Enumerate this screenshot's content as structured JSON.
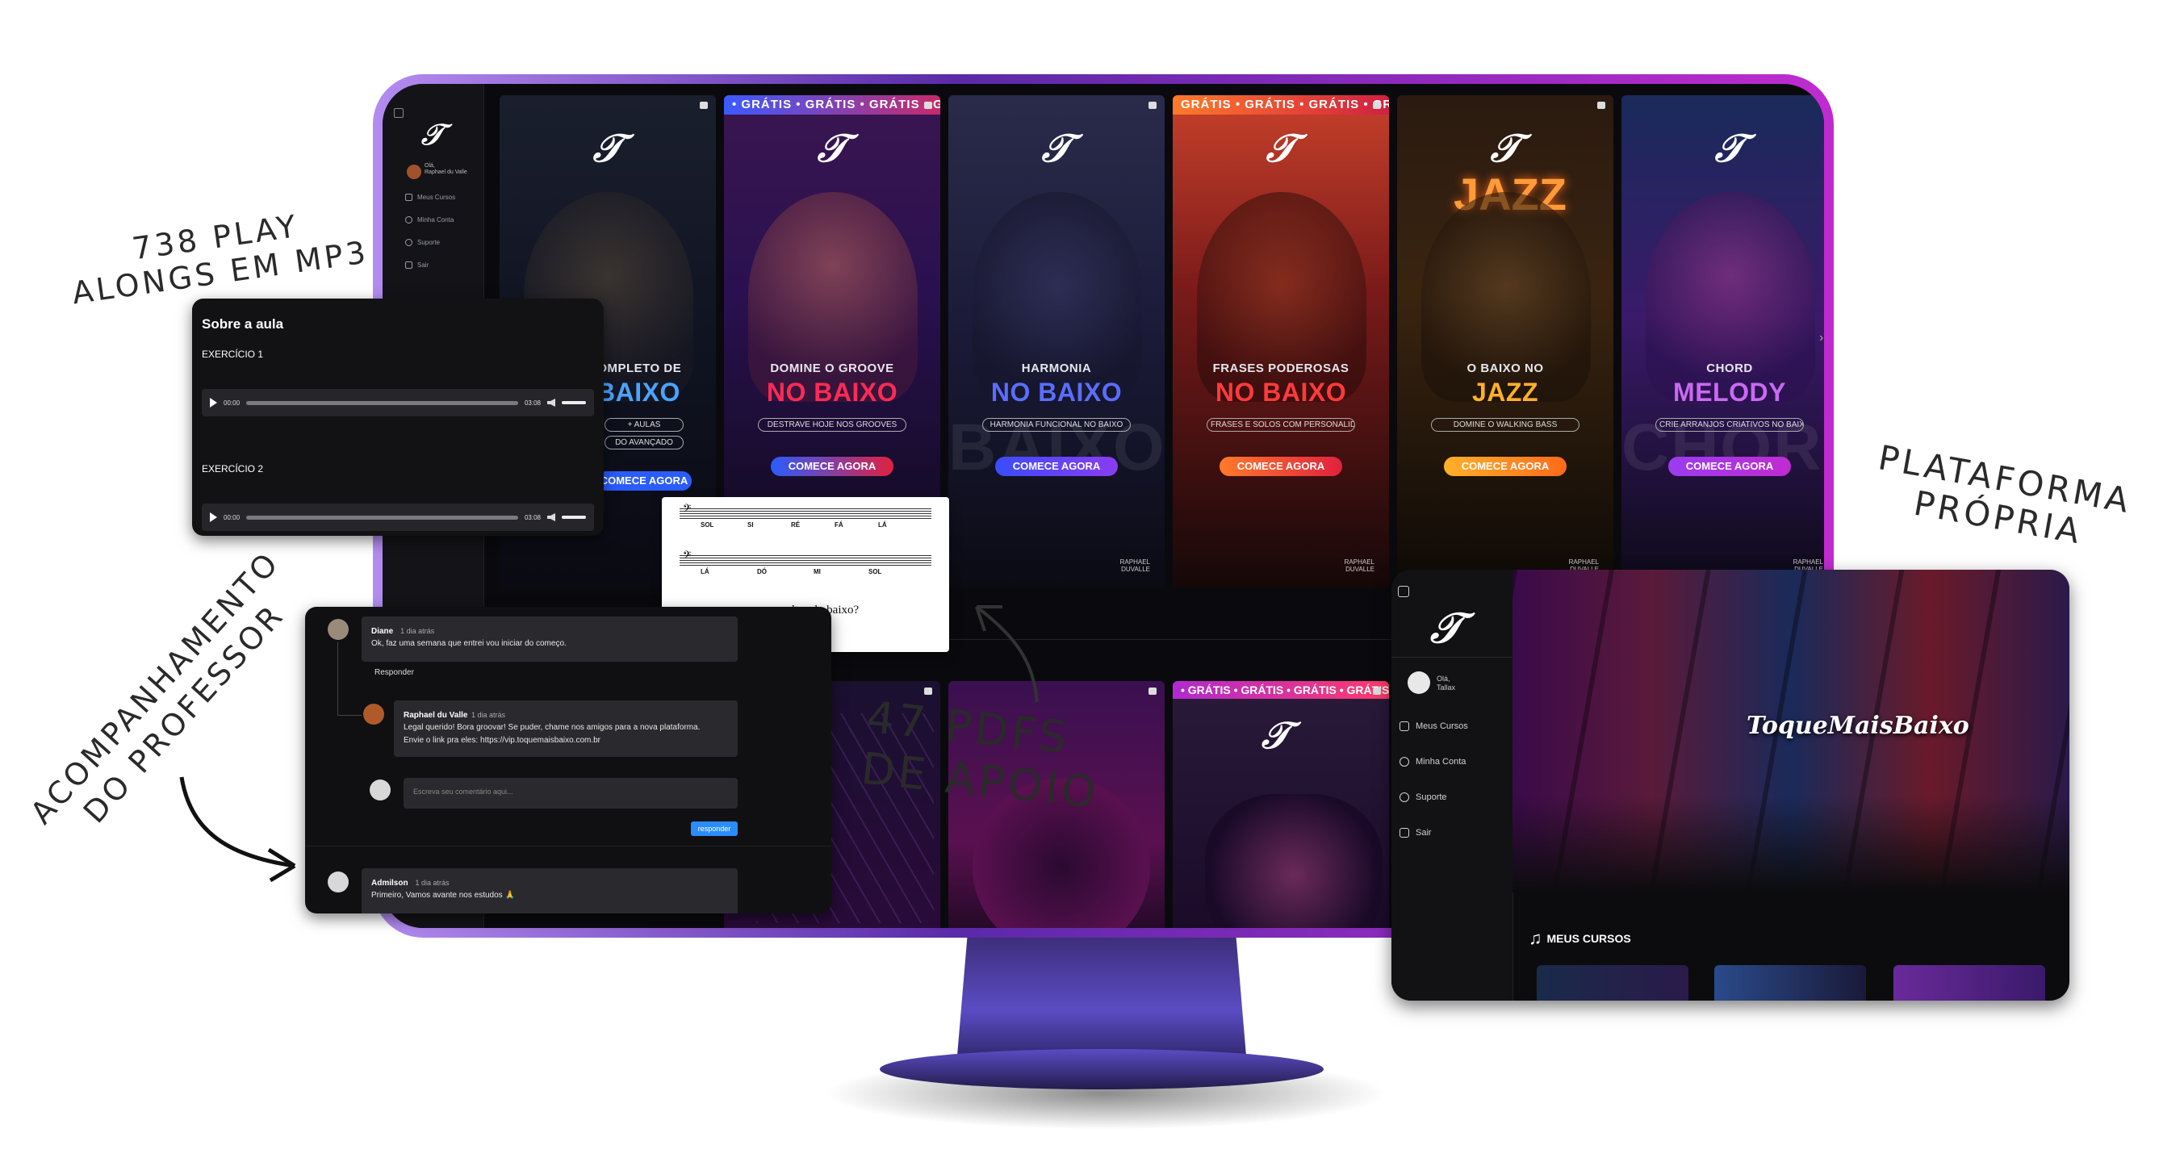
{
  "annotations": {
    "play_alongs_line1": "738 PLAY",
    "play_alongs_line2": "ALONGS EM MP3",
    "pdfs_line1": "47 PDFS",
    "pdfs_line2": "DE APOIO",
    "platform_line1": "PLATAFORMA",
    "platform_line2": "PRÓPRIA",
    "professor_line1": "ACOMPANHAMENTO",
    "professor_line2": "DO PROFESSOR"
  },
  "main_sidebar": {
    "greeting": "Olá,",
    "user_name": "Raphael du Valle",
    "items": [
      "Meus Cursos",
      "Minha Conta",
      "Suporte",
      "Sair"
    ]
  },
  "cards": [
    {
      "banner": "",
      "sub": "COMPLETO DE",
      "big": "BAIXO",
      "tag": "+ AULAS",
      "tag2": "DO AVANÇADO",
      "cta": "COMECE AGORA",
      "bg_word": "",
      "signature": ""
    },
    {
      "banner": "• GRÁTIS • GRÁTIS • GRÁTIS • GRÁTIS",
      "sub": "DOMINE O GROOVE",
      "big": "NO BAIXO",
      "tag": "DESTRAVE HOJE NOS GROOVES",
      "cta": "COMECE AGORA",
      "bg_word": "",
      "signature": ""
    },
    {
      "banner": "",
      "sub": "HARMONIA",
      "big": "NO BAIXO",
      "tag": "HARMONIA FUNCIONAL NO BAIXO",
      "cta": "COMECE AGORA",
      "bg_word": "BAIXO",
      "signature": "RAPHAEL DUVALLE"
    },
    {
      "banner": "GRÁTIS • GRÁTIS • GRÁTIS • GRÁTIS",
      "sub": "FRASES PODEROSAS",
      "big": "NO BAIXO",
      "tag": "FRASES E SOLOS COM PERSONALIDADE",
      "cta": "COMECE AGORA",
      "bg_word": "",
      "signature": "RAPHAEL DUVALLE"
    },
    {
      "banner": "",
      "sub": "O BAIXO NO",
      "big": "JAZZ",
      "tag": "DOMINE O WALKING BASS",
      "cta": "COMECE AGORA",
      "bg_word": "",
      "signature": "RAPHAEL DUVALLE"
    },
    {
      "banner": "",
      "sub": "CHORD",
      "big": "MELODY",
      "tag": "CRIE ARRANJOS CRIATIVOS NO BAIXO",
      "cta": "COMECE AGORA",
      "bg_word": "CHORD",
      "signature": "RAPHAEL DUVALLE"
    }
  ],
  "bottom_cards": [
    {
      "banner": ""
    },
    {
      "banner": ""
    },
    {
      "banner": "• GRÁTIS • GRÁTIS • GRÁTIS • GRÁTIS"
    }
  ],
  "neon_sign": "JAZZ",
  "audio_panel": {
    "title": "Sobre a aula",
    "exercises": [
      {
        "label": "EXERCÍCIO 1",
        "start_time": "00:00",
        "end_time": "03:08"
      },
      {
        "label": "EXERCÍCIO 2",
        "start_time": "00:00",
        "end_time": "03:08"
      }
    ]
  },
  "pdf_panel": {
    "row1_notes": [
      "SOL",
      "SI",
      "RÉ",
      "FÁ",
      "LÁ"
    ],
    "row2_notes": [
      "LÁ",
      "DÓ",
      "MI",
      "SOL"
    ],
    "question": "...as soltas do baixo?"
  },
  "comments_panel": {
    "comments": [
      {
        "name": "Diane",
        "time": "1 dia atrás",
        "text": "Ok, faz uma semana que entrei vou iniciar do começo."
      },
      {
        "name": "Raphael du Valle",
        "time": "1 dia atrás",
        "text": "Legal querido! Bora groovar! Se puder, chame nos amigos para a nova plataforma. Envie o link pra eles: https://vip.toquemaisbaixo.com.br"
      },
      {
        "name": "Admilson",
        "time": "1 dia atrás",
        "text": "Primeiro, Vamos avante nos estudos 🙏"
      }
    ],
    "reply_label": "Responder",
    "comment_placeholder": "Escreva seu comentário aqui...",
    "submit_label": "responder"
  },
  "platform_panel": {
    "greeting": "Olá,",
    "user_name": "Tallax",
    "items": [
      "Meus Cursos",
      "Minha Conta",
      "Suporte",
      "Sair"
    ],
    "brand_logo": "ToqueMaisBaixo",
    "section_title": "MEUS CURSOS"
  },
  "colors": {
    "accent_purple": "#a35bf0",
    "cta_blue": "#2a5cff",
    "cta_red": "#e0213f",
    "cta_orange": "#ff7a2a",
    "cta_purple": "#9b3cf0"
  }
}
